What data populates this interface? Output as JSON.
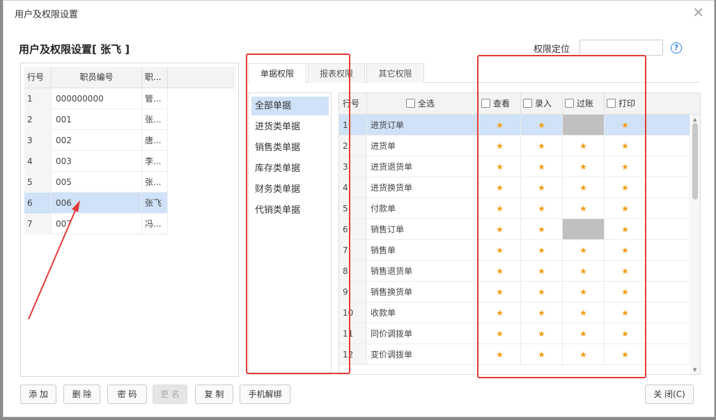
{
  "window": {
    "title": "用户及权限设置",
    "close_glyph": "×"
  },
  "heading": "用户及权限设置[ 张飞 ]",
  "locate": {
    "label": "权限定位",
    "value": ""
  },
  "help_icon": "?",
  "user_table": {
    "headers": [
      "行号",
      "职员编号",
      "职..."
    ],
    "rows": [
      {
        "no": "1",
        "code": "000000000",
        "name": "管..."
      },
      {
        "no": "2",
        "code": "001",
        "name": "张..."
      },
      {
        "no": "3",
        "code": "002",
        "name": "唐..."
      },
      {
        "no": "4",
        "code": "003",
        "name": "李..."
      },
      {
        "no": "5",
        "code": "005",
        "name": "张..."
      },
      {
        "no": "6",
        "code": "006",
        "name": "张飞"
      },
      {
        "no": "7",
        "code": "007",
        "name": "冯..."
      }
    ],
    "selected_row": "6"
  },
  "tabs": [
    {
      "label": "单据权限",
      "active": true
    },
    {
      "label": "报表权限",
      "active": false
    },
    {
      "label": "其它权限",
      "active": false
    }
  ],
  "categories": [
    "全部单据",
    "进货类单据",
    "销售类单据",
    "库存类单据",
    "财务类单据",
    "代销类单据"
  ],
  "selected_category": "全部单据",
  "perm_table": {
    "row_header": "行号",
    "select_all_label": "全选",
    "columns": [
      "查看",
      "录入",
      "过账",
      "打印"
    ],
    "star": "★",
    "rows": [
      {
        "no": "1",
        "name": "进货订单",
        "perms": [
          "star",
          "star",
          "disabled",
          "star"
        ]
      },
      {
        "no": "2",
        "name": "进货单",
        "perms": [
          "star",
          "star",
          "star",
          "star"
        ]
      },
      {
        "no": "3",
        "name": "进货退货单",
        "perms": [
          "star",
          "star",
          "star",
          "star"
        ]
      },
      {
        "no": "4",
        "name": "进货换货单",
        "perms": [
          "star",
          "star",
          "star",
          "star"
        ]
      },
      {
        "no": "5",
        "name": "付款单",
        "perms": [
          "star",
          "star",
          "star",
          "star"
        ]
      },
      {
        "no": "6",
        "name": "销售订单",
        "perms": [
          "star",
          "star",
          "disabled",
          "star"
        ]
      },
      {
        "no": "7",
        "name": "销售单",
        "perms": [
          "star",
          "star",
          "star",
          "star"
        ]
      },
      {
        "no": "8",
        "name": "销售退货单",
        "perms": [
          "star",
          "star",
          "star",
          "star"
        ]
      },
      {
        "no": "9",
        "name": "销售换货单",
        "perms": [
          "star",
          "star",
          "star",
          "star"
        ]
      },
      {
        "no": "10",
        "name": "收款单",
        "perms": [
          "star",
          "star",
          "star",
          "star"
        ]
      },
      {
        "no": "11",
        "name": "同价调拨单",
        "perms": [
          "star",
          "star",
          "star",
          "star"
        ]
      },
      {
        "no": "12",
        "name": "变价调拨单",
        "perms": [
          "star",
          "star",
          "star",
          "star"
        ]
      }
    ],
    "selected_row": "1"
  },
  "buttons": {
    "add": "添 加",
    "delete": "删 除",
    "password": "密 码",
    "rename": "更 名",
    "copy": "复 制",
    "unbind_phone": "手机解绑",
    "close": "关 闭(C)"
  },
  "colors": {
    "highlight_red": "#e53935",
    "star": "#f39c12",
    "selection": "#cfe2f7",
    "help_blue": "#2f7fe0"
  }
}
